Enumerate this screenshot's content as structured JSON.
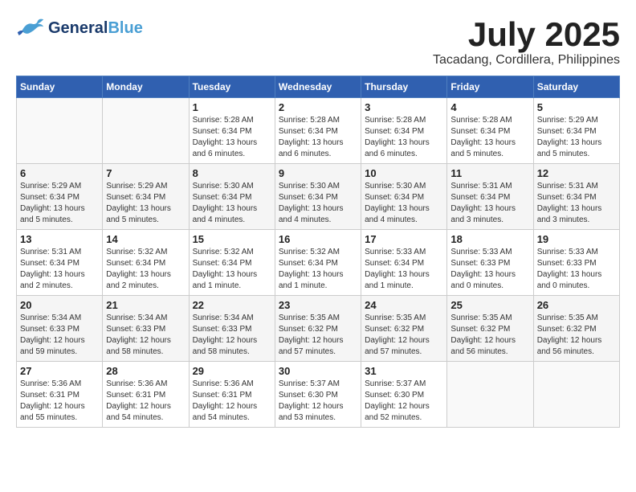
{
  "header": {
    "logo_general": "General",
    "logo_blue": "Blue",
    "month_title": "July 2025",
    "location": "Tacadang, Cordillera, Philippines"
  },
  "days_of_week": [
    "Sunday",
    "Monday",
    "Tuesday",
    "Wednesday",
    "Thursday",
    "Friday",
    "Saturday"
  ],
  "weeks": [
    [
      {
        "day": "",
        "detail": ""
      },
      {
        "day": "",
        "detail": ""
      },
      {
        "day": "1",
        "detail": "Sunrise: 5:28 AM\nSunset: 6:34 PM\nDaylight: 13 hours\nand 6 minutes."
      },
      {
        "day": "2",
        "detail": "Sunrise: 5:28 AM\nSunset: 6:34 PM\nDaylight: 13 hours\nand 6 minutes."
      },
      {
        "day": "3",
        "detail": "Sunrise: 5:28 AM\nSunset: 6:34 PM\nDaylight: 13 hours\nand 6 minutes."
      },
      {
        "day": "4",
        "detail": "Sunrise: 5:28 AM\nSunset: 6:34 PM\nDaylight: 13 hours\nand 5 minutes."
      },
      {
        "day": "5",
        "detail": "Sunrise: 5:29 AM\nSunset: 6:34 PM\nDaylight: 13 hours\nand 5 minutes."
      }
    ],
    [
      {
        "day": "6",
        "detail": "Sunrise: 5:29 AM\nSunset: 6:34 PM\nDaylight: 13 hours\nand 5 minutes."
      },
      {
        "day": "7",
        "detail": "Sunrise: 5:29 AM\nSunset: 6:34 PM\nDaylight: 13 hours\nand 5 minutes."
      },
      {
        "day": "8",
        "detail": "Sunrise: 5:30 AM\nSunset: 6:34 PM\nDaylight: 13 hours\nand 4 minutes."
      },
      {
        "day": "9",
        "detail": "Sunrise: 5:30 AM\nSunset: 6:34 PM\nDaylight: 13 hours\nand 4 minutes."
      },
      {
        "day": "10",
        "detail": "Sunrise: 5:30 AM\nSunset: 6:34 PM\nDaylight: 13 hours\nand 4 minutes."
      },
      {
        "day": "11",
        "detail": "Sunrise: 5:31 AM\nSunset: 6:34 PM\nDaylight: 13 hours\nand 3 minutes."
      },
      {
        "day": "12",
        "detail": "Sunrise: 5:31 AM\nSunset: 6:34 PM\nDaylight: 13 hours\nand 3 minutes."
      }
    ],
    [
      {
        "day": "13",
        "detail": "Sunrise: 5:31 AM\nSunset: 6:34 PM\nDaylight: 13 hours\nand 2 minutes."
      },
      {
        "day": "14",
        "detail": "Sunrise: 5:32 AM\nSunset: 6:34 PM\nDaylight: 13 hours\nand 2 minutes."
      },
      {
        "day": "15",
        "detail": "Sunrise: 5:32 AM\nSunset: 6:34 PM\nDaylight: 13 hours\nand 1 minute."
      },
      {
        "day": "16",
        "detail": "Sunrise: 5:32 AM\nSunset: 6:34 PM\nDaylight: 13 hours\nand 1 minute."
      },
      {
        "day": "17",
        "detail": "Sunrise: 5:33 AM\nSunset: 6:34 PM\nDaylight: 13 hours\nand 1 minute."
      },
      {
        "day": "18",
        "detail": "Sunrise: 5:33 AM\nSunset: 6:33 PM\nDaylight: 13 hours\nand 0 minutes."
      },
      {
        "day": "19",
        "detail": "Sunrise: 5:33 AM\nSunset: 6:33 PM\nDaylight: 13 hours\nand 0 minutes."
      }
    ],
    [
      {
        "day": "20",
        "detail": "Sunrise: 5:34 AM\nSunset: 6:33 PM\nDaylight: 12 hours\nand 59 minutes."
      },
      {
        "day": "21",
        "detail": "Sunrise: 5:34 AM\nSunset: 6:33 PM\nDaylight: 12 hours\nand 58 minutes."
      },
      {
        "day": "22",
        "detail": "Sunrise: 5:34 AM\nSunset: 6:33 PM\nDaylight: 12 hours\nand 58 minutes."
      },
      {
        "day": "23",
        "detail": "Sunrise: 5:35 AM\nSunset: 6:32 PM\nDaylight: 12 hours\nand 57 minutes."
      },
      {
        "day": "24",
        "detail": "Sunrise: 5:35 AM\nSunset: 6:32 PM\nDaylight: 12 hours\nand 57 minutes."
      },
      {
        "day": "25",
        "detail": "Sunrise: 5:35 AM\nSunset: 6:32 PM\nDaylight: 12 hours\nand 56 minutes."
      },
      {
        "day": "26",
        "detail": "Sunrise: 5:35 AM\nSunset: 6:32 PM\nDaylight: 12 hours\nand 56 minutes."
      }
    ],
    [
      {
        "day": "27",
        "detail": "Sunrise: 5:36 AM\nSunset: 6:31 PM\nDaylight: 12 hours\nand 55 minutes."
      },
      {
        "day": "28",
        "detail": "Sunrise: 5:36 AM\nSunset: 6:31 PM\nDaylight: 12 hours\nand 54 minutes."
      },
      {
        "day": "29",
        "detail": "Sunrise: 5:36 AM\nSunset: 6:31 PM\nDaylight: 12 hours\nand 54 minutes."
      },
      {
        "day": "30",
        "detail": "Sunrise: 5:37 AM\nSunset: 6:30 PM\nDaylight: 12 hours\nand 53 minutes."
      },
      {
        "day": "31",
        "detail": "Sunrise: 5:37 AM\nSunset: 6:30 PM\nDaylight: 12 hours\nand 52 minutes."
      },
      {
        "day": "",
        "detail": ""
      },
      {
        "day": "",
        "detail": ""
      }
    ]
  ]
}
